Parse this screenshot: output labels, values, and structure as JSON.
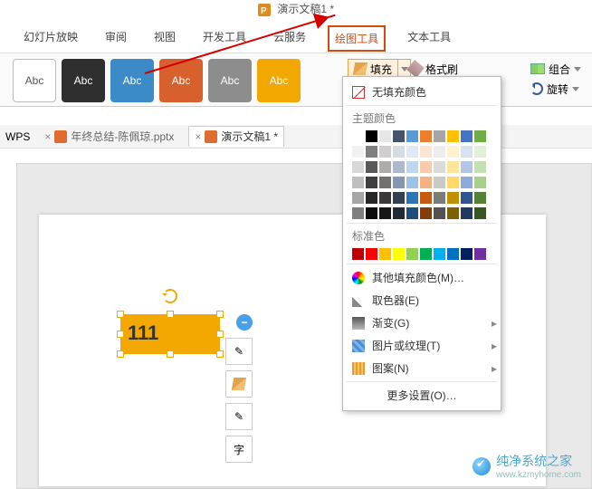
{
  "titlebar": {
    "doc_name": "演示文稿1 *"
  },
  "ribbon": {
    "tabs": [
      "幻灯片放映",
      "审阅",
      "视图",
      "开发工具",
      "云服务",
      "绘图工具",
      "文本工具"
    ],
    "active_index": 5
  },
  "style_gallery": {
    "sample_text": "Abc"
  },
  "fill_button": {
    "label": "填充"
  },
  "format_painter": {
    "label": "格式刷"
  },
  "right_tools": {
    "combine": "组合",
    "rotate": "旋转"
  },
  "tabstrip": {
    "wps_label": "WPS",
    "doc1": "年终总结-陈佩琼.pptx",
    "doc2": "演示文稿1 *"
  },
  "shape": {
    "text": "111"
  },
  "dropdown": {
    "no_fill": "无填充颜色",
    "theme_colors_header": "主题颜色",
    "theme_row1": [
      "#ffffff",
      "#000000",
      "#e7e6e6",
      "#44546a",
      "#5b9bd5",
      "#ed7d31",
      "#a5a5a5",
      "#ffc000",
      "#4472c4",
      "#70ad47"
    ],
    "theme_shades": [
      [
        "#f2f2f2",
        "#7f7f7f",
        "#d0cece",
        "#d6dce4",
        "#deebf6",
        "#fbe5d5",
        "#ededed",
        "#fff2cc",
        "#d9e2f3",
        "#e2efd9"
      ],
      [
        "#d8d8d8",
        "#595959",
        "#aeabab",
        "#adb9ca",
        "#bdd7ee",
        "#f7cbac",
        "#dbdbdb",
        "#fee599",
        "#b4c6e7",
        "#c5e0b3"
      ],
      [
        "#bfbfbf",
        "#3f3f3f",
        "#757070",
        "#8496b0",
        "#9cc3e5",
        "#f4b183",
        "#c9c9c9",
        "#ffd965",
        "#8eaadb",
        "#a8d08d"
      ],
      [
        "#a5a5a5",
        "#262626",
        "#3a3838",
        "#323f4f",
        "#2e75b5",
        "#c55a11",
        "#7b7b7b",
        "#bf9000",
        "#2f5496",
        "#538135"
      ],
      [
        "#7f7f7f",
        "#0c0c0c",
        "#171616",
        "#222a35",
        "#1e4e79",
        "#833c0b",
        "#525252",
        "#7f6000",
        "#1f3864",
        "#375623"
      ]
    ],
    "standard_colors_header": "标准色",
    "standard_colors": [
      "#c00000",
      "#ff0000",
      "#ffc000",
      "#ffff00",
      "#92d050",
      "#00b050",
      "#00b0f0",
      "#0070c0",
      "#002060",
      "#7030a0"
    ],
    "more_colors": "其他填充颜色(M)…",
    "eyedropper": "取色器(E)",
    "gradient": "渐变(G)",
    "texture": "图片或纹理(T)",
    "pattern": "图案(N)",
    "more_settings": "更多设置(O)…"
  },
  "watermark": {
    "text": "纯净系统之家",
    "url": "www.kzmyhome.com"
  }
}
